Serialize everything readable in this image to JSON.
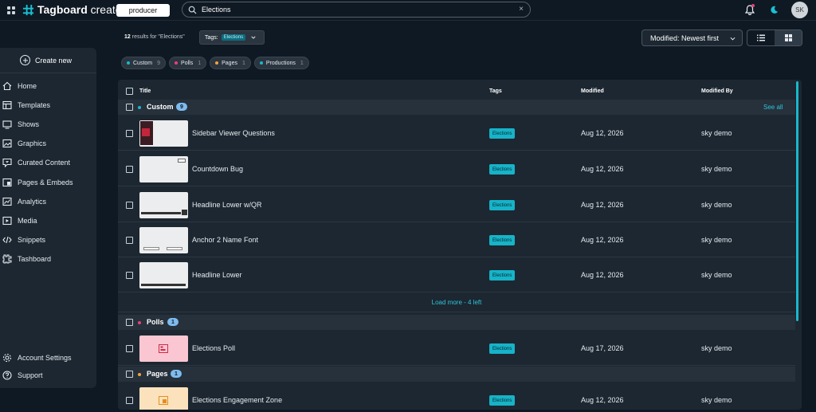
{
  "header": {
    "brand": "Tagboard creator",
    "brand_bold": "Tagboard",
    "brand_light": " creator",
    "workspace": "producer",
    "search_value": "Elections",
    "search_clear": "×",
    "avatar_initials": "SK"
  },
  "sidebar": {
    "create_new": "Create new",
    "items": [
      {
        "label": "Home",
        "icon": "home-icon"
      },
      {
        "label": "Templates",
        "icon": "templates-icon"
      },
      {
        "label": "Shows",
        "icon": "shows-icon"
      },
      {
        "label": "Graphics",
        "icon": "graphics-icon"
      },
      {
        "label": "Curated Content",
        "icon": "curated-content-icon"
      },
      {
        "label": "Pages & Embeds",
        "icon": "pages-icon"
      },
      {
        "label": "Analytics",
        "icon": "analytics-icon"
      },
      {
        "label": "Media",
        "icon": "media-icon"
      },
      {
        "label": "Snippets",
        "icon": "snippets-icon"
      },
      {
        "label": "Tashboard",
        "icon": "tashboard-icon"
      }
    ],
    "footer": [
      {
        "label": "Account Settings",
        "icon": "gear-icon"
      },
      {
        "label": "Support",
        "icon": "help-icon"
      }
    ]
  },
  "results": {
    "count": "12",
    "suffix": " results for \"Elections\"",
    "tags_label": "Tags:",
    "tags_chip": "Elections",
    "sort_value": "Modified: Newest first"
  },
  "type_chips": [
    {
      "label": "Custom",
      "count": "9",
      "color": "#19b8cc"
    },
    {
      "label": "Polls",
      "count": "1",
      "color": "#e9407a"
    },
    {
      "label": "Pages",
      "count": "1",
      "color": "#f2a33a"
    },
    {
      "label": "Productions",
      "count": "1",
      "color": "#19b8cc"
    }
  ],
  "table": {
    "columns": {
      "title": "Title",
      "tags": "Tags",
      "modified": "Modified",
      "modified_by": "Modified By"
    },
    "groups": [
      {
        "name": "Custom",
        "count": "9",
        "color": "#19b8cc",
        "see_all": "See all"
      },
      {
        "name": "Polls",
        "count": "1",
        "color": "#e9407a"
      },
      {
        "name": "Pages",
        "count": "1",
        "color": "#f2a33a"
      }
    ],
    "rows": [
      {
        "title": "Sidebar Viewer Questions",
        "tag": "Elections",
        "modified": "Aug 12, 2026",
        "by": "sky demo"
      },
      {
        "title": "Countdown Bug",
        "tag": "Elections",
        "modified": "Aug 12, 2026",
        "by": "sky demo"
      },
      {
        "title": "Headline Lower w/QR",
        "tag": "Elections",
        "modified": "Aug 12, 2026",
        "by": "sky demo"
      },
      {
        "title": "Anchor 2 Name Font",
        "tag": "Elections",
        "modified": "Aug 12, 2026",
        "by": "sky demo"
      },
      {
        "title": "Headline Lower",
        "tag": "Elections",
        "modified": "Aug 12, 2026",
        "by": "sky demo"
      },
      {
        "title": "Elections Poll",
        "tag": "Elections",
        "modified": "Aug 17, 2026",
        "by": "sky demo"
      },
      {
        "title": "Elections Engagement Zone",
        "tag": "Elections",
        "modified": "Aug 12, 2026",
        "by": "sky demo"
      }
    ],
    "load_more": "Load more - 4 left"
  }
}
